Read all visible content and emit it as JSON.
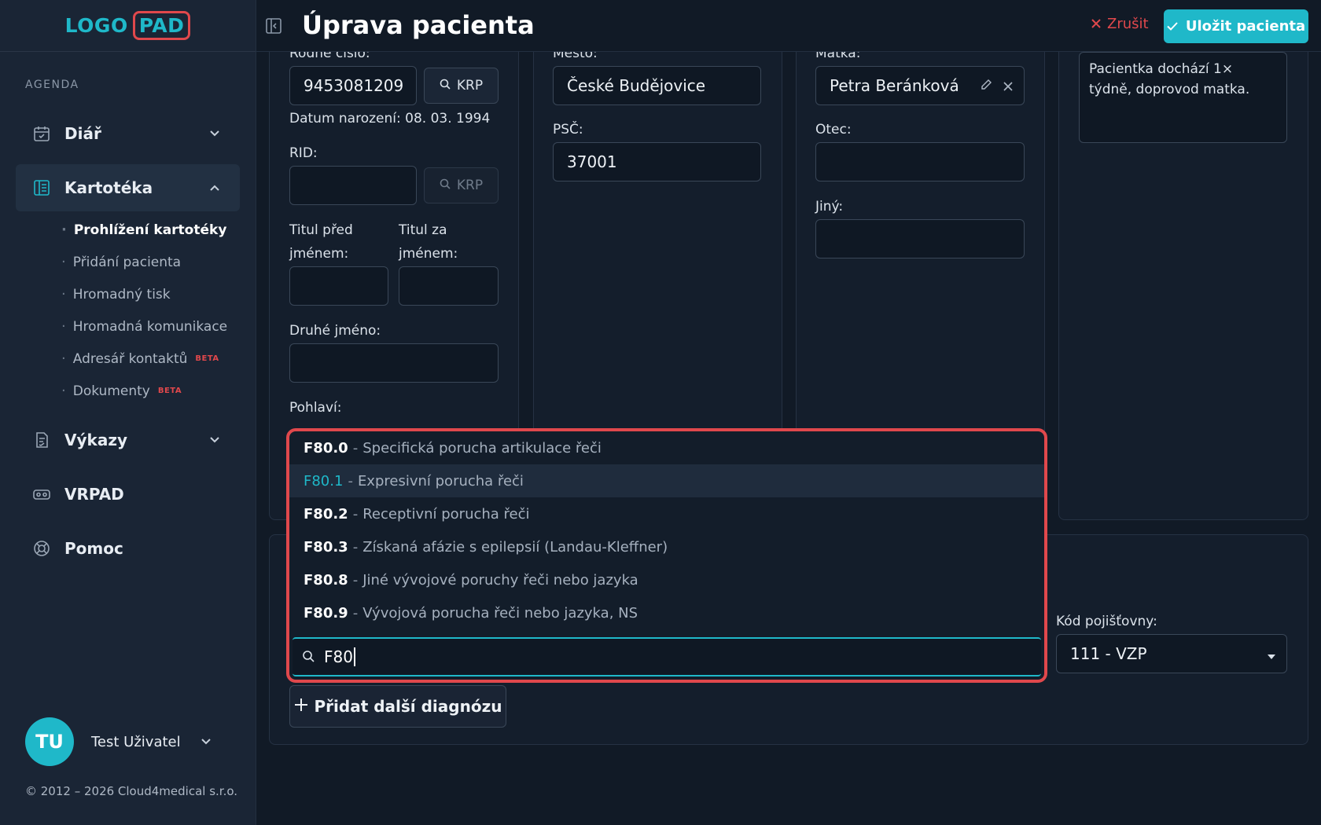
{
  "app": {
    "logo_part1": "LOGO",
    "logo_part2": "PAD",
    "brand_color": "#1fb8c9",
    "danger_color": "#e0484c"
  },
  "sidebar": {
    "section": "AGENDA",
    "items": [
      {
        "label": "Diář",
        "icon": "calendar-icon",
        "expanded": false
      },
      {
        "label": "Kartotéka",
        "icon": "card-index-icon",
        "expanded": true
      },
      {
        "label": "Výkazy",
        "icon": "report-icon",
        "expanded": false
      },
      {
        "label": "VRPAD",
        "icon": "vr-headset-icon"
      },
      {
        "label": "Pomoc",
        "icon": "lifebuoy-icon"
      }
    ],
    "subitems": [
      {
        "label": "Prohlížení kartotéky",
        "current": true
      },
      {
        "label": "Přidání pacienta"
      },
      {
        "label": "Hromadný tisk"
      },
      {
        "label": "Hromadná komunikace"
      },
      {
        "label": "Adresář kontaktů",
        "badge": "BETA"
      },
      {
        "label": "Dokumenty",
        "badge": "BETA"
      }
    ],
    "user": {
      "initials": "TU",
      "name": "Test Uživatel"
    },
    "copyright": "© 2012 – 2026 Cloud4medical s.r.o."
  },
  "topbar": {
    "title": "Úprava pacienta",
    "cancel_label": "Zrušit",
    "save_label": "Uložit pacienta"
  },
  "form": {
    "birth_number_label": "Rodné číslo:",
    "birth_number": "9453081209",
    "krp_label": "KRP",
    "birth_date_text": "Datum narození: 08. 03. 1994",
    "rid_label": "RID:",
    "rid": "",
    "title_before_label_1": "Titul před",
    "title_before_label_2": "jménem:",
    "title_after_label_1": "Titul za",
    "title_after_label_2": "jménem:",
    "middle_name_label": "Druhé jméno:",
    "gender_label": "Pohlaví:",
    "city_label": "Město:",
    "city": "České Budějovice",
    "zip_label": "PSČ:",
    "zip": "37001",
    "mother_label": "Matka:",
    "mother": "Petra Beránková",
    "father_label": "Otec:",
    "other_label": "Jiný:",
    "note": "Pacientka dochází 1× týdně, doprovod matka.",
    "insurance_label": "Kód pojišťovny:",
    "insurance_value": "111 - VZP",
    "add_diagnosis_label": "Přidat další diagnózu"
  },
  "diagnosis_dropdown": {
    "search_value": "F80",
    "separator": "-",
    "options": [
      {
        "code": "F80.0",
        "desc": "Specifická porucha artikulace řeči"
      },
      {
        "code": "F80.1",
        "desc": "Expresivní porucha řeči",
        "highlighted": true
      },
      {
        "code": "F80.2",
        "desc": "Receptivní porucha řeči"
      },
      {
        "code": "F80.3",
        "desc": "Získaná afázie s epilepsií (Landau-Kleffner)"
      },
      {
        "code": "F80.8",
        "desc": "Jiné vývojové poruchy řeči nebo jazyka"
      },
      {
        "code": "F80.9",
        "desc": "Vývojová porucha řeči nebo jazyka, NS"
      }
    ]
  }
}
